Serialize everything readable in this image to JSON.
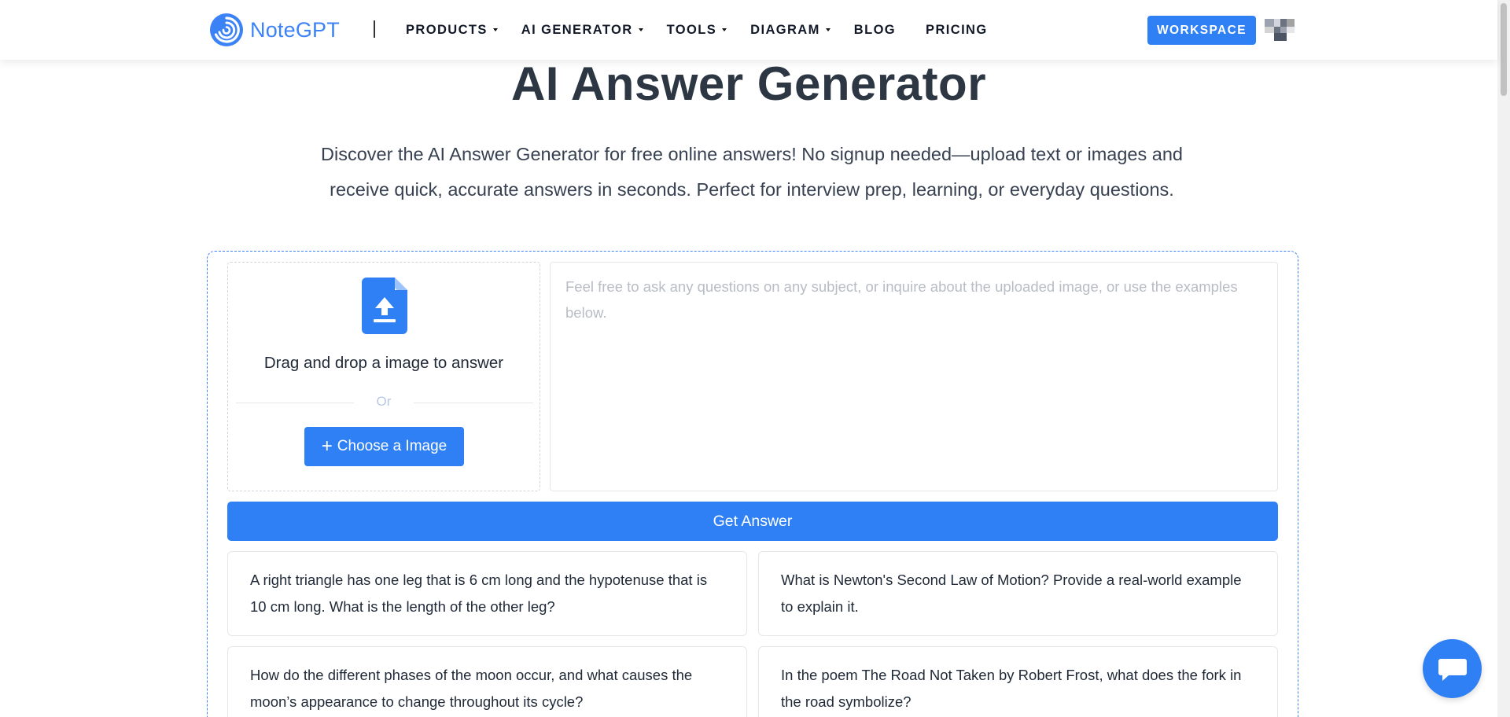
{
  "header": {
    "logo_text": "NoteGPT",
    "nav": [
      {
        "label": "PRODUCTS",
        "dropdown": true
      },
      {
        "label": "AI GENERATOR",
        "dropdown": true
      },
      {
        "label": "TOOLS",
        "dropdown": true
      },
      {
        "label": "DIAGRAM",
        "dropdown": true
      },
      {
        "label": "BLOG",
        "dropdown": false
      },
      {
        "label": "PRICING",
        "dropdown": false
      }
    ],
    "workspace_label": "WORKSPACE"
  },
  "hero": {
    "title": "AI Answer Generator",
    "description": "Discover the AI Answer Generator for free online answers! No signup needed—upload text or images and receive quick, accurate answers in seconds. Perfect for interview prep, learning, or everyday questions."
  },
  "upload": {
    "drag_text": "Drag and drop a image to answer",
    "or_text": "Or",
    "choose_label": "Choose a Image"
  },
  "question": {
    "value": "",
    "placeholder": "Feel free to ask any questions on any subject, or inquire about the uploaded image, or use the examples below."
  },
  "get_answer_label": "Get Answer",
  "examples": [
    "A right triangle has one leg that is 6 cm long and the hypotenuse that is 10 cm long. What is the length of the other leg?",
    "What is Newton's Second Law of Motion? Provide a real-world example to explain it.",
    "How do the different phases of the moon occur, and what causes the moon’s appearance to change throughout its cycle?",
    "In the poem The Road Not Taken by Robert Frost, what does the fork in the road symbolize?"
  ],
  "colors": {
    "primary": "#2f80f5",
    "title": "#2d3643",
    "panel_border": "#3b82f6"
  },
  "icons": {
    "logo": "spiral-logo-icon",
    "upload": "file-upload-icon",
    "chat": "chat-bubble-icon",
    "avatar": "pixel-avatar-icon"
  }
}
